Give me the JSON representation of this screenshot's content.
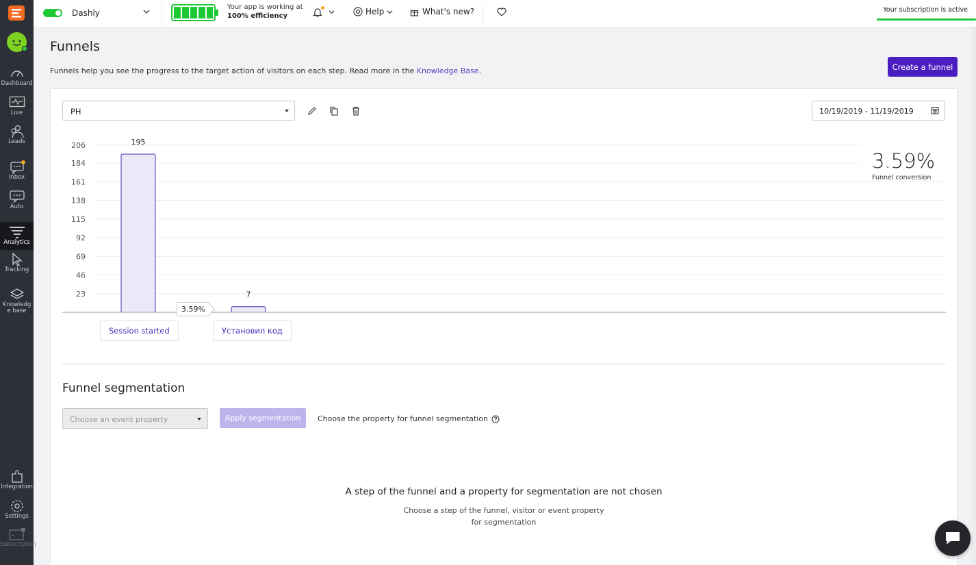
{
  "sidebar": {
    "items": [
      {
        "label": "Dashboard"
      },
      {
        "label": "Live"
      },
      {
        "label": "Leads"
      },
      {
        "label": "Inbox"
      },
      {
        "label": "Auto"
      },
      {
        "label": "Analytics"
      },
      {
        "label": "Tracking"
      },
      {
        "label": "Knowledge base"
      },
      {
        "label": "Integration"
      },
      {
        "label": "Settings"
      },
      {
        "label": "Subscription"
      }
    ]
  },
  "topbar": {
    "app_name": "Dashly",
    "efficiency_line1": "Your app is working at",
    "efficiency_line2": "100% efficiency",
    "help_label": "Help",
    "whatsnew_label": "What's new?",
    "subscription_text": "Your subscription is active"
  },
  "page": {
    "title": "Funnels",
    "description": "Funnels help you see the progress to the target action of visitors on each step. Read more in the",
    "kb_link": "Knowledge Base",
    "desc_end": ".",
    "create_button": "Create a funnel"
  },
  "funnel": {
    "selected": "PH",
    "date_range": "10/19/2019 - 11/19/2019",
    "conversion_value": "3.59%",
    "conversion_label": "Funnel conversion",
    "step_conversion": "3.59%",
    "steps": [
      "Session started",
      "Установил код"
    ]
  },
  "chart_data": {
    "type": "bar",
    "categories": [
      "Session started",
      "Установил код"
    ],
    "values": [
      195,
      7
    ],
    "yticks": [
      23,
      46,
      69,
      92,
      115,
      138,
      161,
      184,
      206
    ],
    "ylim": [
      0,
      206
    ],
    "grid": true,
    "bar_color": "#ebe8f8",
    "bar_border": "#4a2fb5"
  },
  "segmentation": {
    "title": "Funnel segmentation",
    "property_placeholder": "Choose an event property",
    "apply_button": "Apply segmentation",
    "hint": "Choose the property for funnel segmentation",
    "empty_title": "A step of the funnel and a property for segmentation are not chosen",
    "empty_sub_line1": "Choose a step of the funnel, visitor or event property",
    "empty_sub_line2": "for segmentation"
  }
}
